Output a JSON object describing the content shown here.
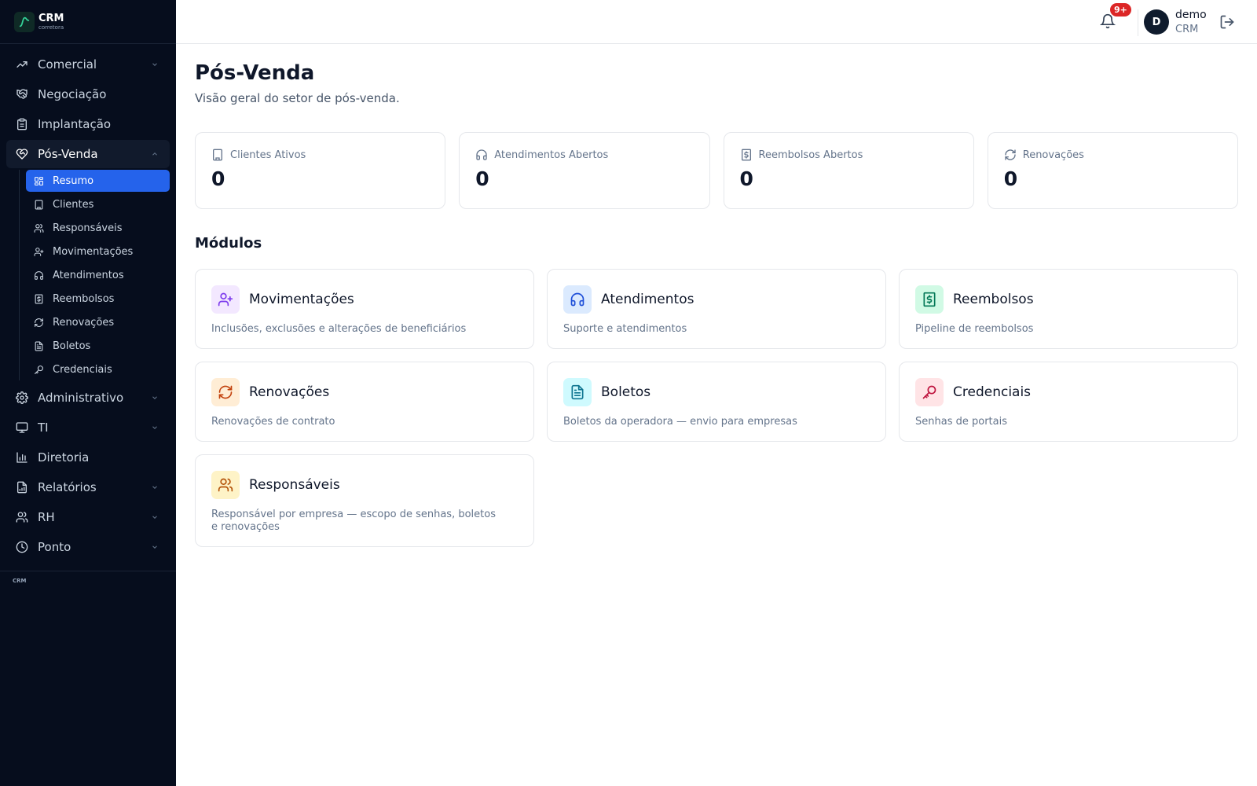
{
  "brand": {
    "name": "CRM",
    "subtitle": "corretora"
  },
  "sidebar": {
    "items": [
      {
        "label": "Comercial"
      },
      {
        "label": "Negociação"
      },
      {
        "label": "Implantação"
      },
      {
        "label": "Pós-Venda"
      },
      {
        "label": "Administrativo"
      },
      {
        "label": "TI"
      },
      {
        "label": "Diretoria"
      },
      {
        "label": "Relatórios"
      },
      {
        "label": "RH"
      },
      {
        "label": "Ponto"
      }
    ],
    "sub_items": [
      {
        "label": "Resumo"
      },
      {
        "label": "Clientes"
      },
      {
        "label": "Responsáveis"
      },
      {
        "label": "Movimentações"
      },
      {
        "label": "Atendimentos"
      },
      {
        "label": "Reembolsos"
      },
      {
        "label": "Renovações"
      },
      {
        "label": "Boletos"
      },
      {
        "label": "Credenciais"
      }
    ],
    "footer": "CRM"
  },
  "header": {
    "notifications_badge": "9+",
    "avatar_initial": "D",
    "user_name": "demo",
    "user_role": "CRM"
  },
  "page": {
    "title": "Pós-Venda",
    "subtitle": "Visão geral do setor de pós-venda."
  },
  "stats": [
    {
      "label": "Clientes Ativos",
      "value": "0",
      "icon": "building-icon"
    },
    {
      "label": "Atendimentos Abertos",
      "value": "0",
      "icon": "headphones-icon"
    },
    {
      "label": "Reembolsos Abertos",
      "value": "0",
      "icon": "receipt-icon"
    },
    {
      "label": "Renovações",
      "value": "0",
      "icon": "refresh-icon"
    }
  ],
  "modules_section": {
    "title": "Módulos"
  },
  "modules": [
    {
      "title": "Movimentações",
      "description": "Inclusões, exclusões e alterações de beneficiários",
      "icon": "user-plus-icon",
      "bg": "#f3e8ff",
      "color": "#7c3aed"
    },
    {
      "title": "Atendimentos",
      "description": "Suporte e atendimentos",
      "icon": "headphones-icon",
      "bg": "#dbeafe",
      "color": "#1d4ed8"
    },
    {
      "title": "Reembolsos",
      "description": "Pipeline de reembolsos",
      "icon": "receipt-icon",
      "bg": "#d1fae5",
      "color": "#047857"
    },
    {
      "title": "Renovações",
      "description": "Renovações de contrato",
      "icon": "refresh-icon",
      "bg": "#ffedd5",
      "color": "#c2410c"
    },
    {
      "title": "Boletos",
      "description": "Boletos da operadora — envio para empresas",
      "icon": "file-text-icon",
      "bg": "#cffafe",
      "color": "#0e7490"
    },
    {
      "title": "Credenciais",
      "description": "Senhas de portais",
      "icon": "key-icon",
      "bg": "#ffe4e6",
      "color": "#be123c"
    },
    {
      "title": "Responsáveis",
      "description": "Responsável por empresa — escopo de senhas, boletos e renovações",
      "icon": "users-icon",
      "bg": "#fef3c7",
      "color": "#b45309"
    }
  ],
  "colors": {
    "sidebar_bg": "#060d1d",
    "active_sub_item": "#2563eb",
    "badge": "#dc2626"
  }
}
